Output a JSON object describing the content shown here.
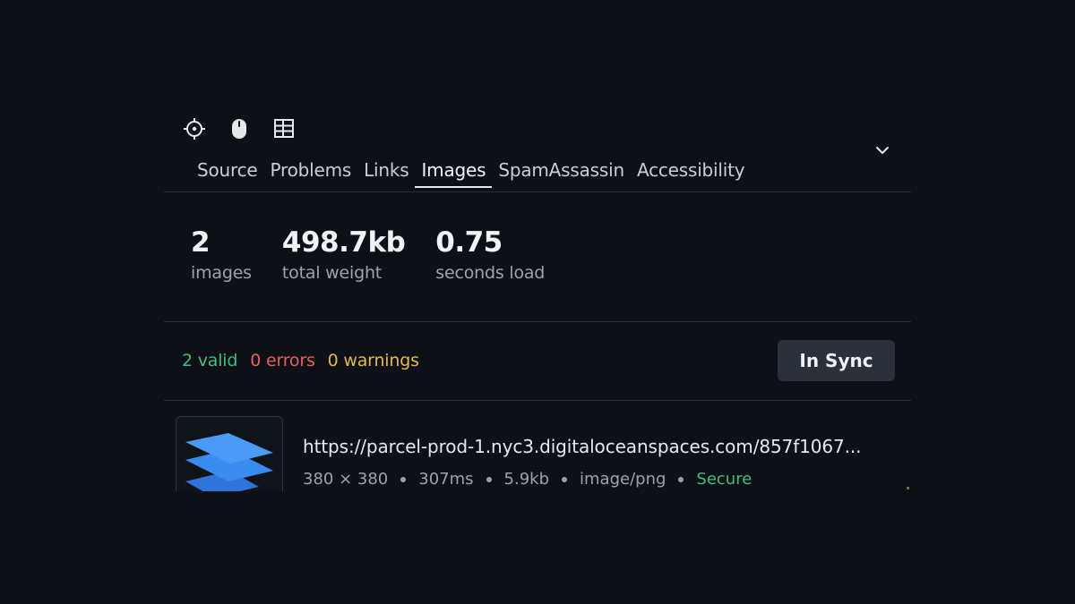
{
  "toolbar": {
    "icons": [
      "crosshair-icon",
      "mouse-icon",
      "table-icon"
    ]
  },
  "tabs": [
    {
      "label": "Source"
    },
    {
      "label": "Problems"
    },
    {
      "label": "Links"
    },
    {
      "label": "Images",
      "active": true
    },
    {
      "label": "SpamAssassin"
    },
    {
      "label": "Accessibility"
    }
  ],
  "stats": {
    "images": {
      "value": "2",
      "label": "images"
    },
    "weight": {
      "value": "498.7kb",
      "label": "total weight"
    },
    "load": {
      "value": "0.75",
      "label": "seconds load"
    }
  },
  "summary": {
    "valid": "2 valid",
    "errors": "0 errors",
    "warnings": "0 warnings"
  },
  "sync_button": "In Sync",
  "images": [
    {
      "url": "https://parcel-prod-1.nyc3.digitaloceanspaces.com/857f1067...",
      "dimensions": "380 × 380",
      "time": "307ms",
      "size": "5.9kb",
      "type": "image/png",
      "security": "Secure"
    }
  ],
  "colors": {
    "background": "#0d1117",
    "valid": "#3fbf7a",
    "error": "#e8605f",
    "warning": "#e6b84a",
    "button": "#2b313a",
    "thumb_blue": "#3b8cf0"
  }
}
